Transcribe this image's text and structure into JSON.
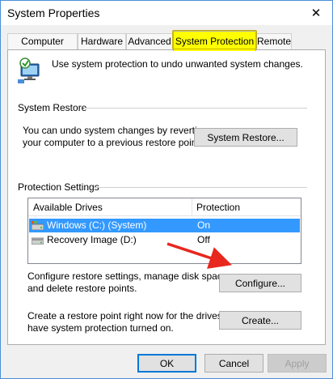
{
  "window": {
    "title": "System Properties",
    "close_glyph": "✕"
  },
  "tabs": [
    {
      "label": "Computer Name",
      "active": false
    },
    {
      "label": "Hardware",
      "active": false
    },
    {
      "label": "Advanced",
      "active": false
    },
    {
      "label": "System Protection",
      "active": true,
      "highlight_color": "#ffff00"
    },
    {
      "label": "Remote",
      "active": false
    }
  ],
  "intro": {
    "icon": "computer-shield-icon",
    "text": "Use system protection to undo unwanted system changes."
  },
  "system_restore": {
    "group_title": "System Restore",
    "description_line1": "You can undo system changes by reverting",
    "description_line2": "your computer to a previous restore point.",
    "button_label": "System Restore..."
  },
  "protection": {
    "group_title": "Protection Settings",
    "columns": [
      "Available Drives",
      "Protection"
    ],
    "drives": [
      {
        "name": "Windows (C:) (System)",
        "protection": "On",
        "selected": true,
        "icon": "system-drive-icon"
      },
      {
        "name": "Recovery Image (D:)",
        "protection": "Off",
        "selected": false,
        "icon": "drive-icon"
      }
    ],
    "configure_line1": "Configure restore settings, manage disk space,",
    "configure_line2": "and delete restore points.",
    "configure_button": "Configure...",
    "create_line1": "Create a restore point right now for the drives that",
    "create_line2": "have system protection turned on.",
    "create_button": "Create..."
  },
  "annotation": {
    "arrow_color": "#e8271f"
  },
  "footer": {
    "ok": "OK",
    "cancel": "Cancel",
    "apply": "Apply"
  },
  "colors": {
    "selection": "#3399ff",
    "accent_border": "#0078d7"
  }
}
